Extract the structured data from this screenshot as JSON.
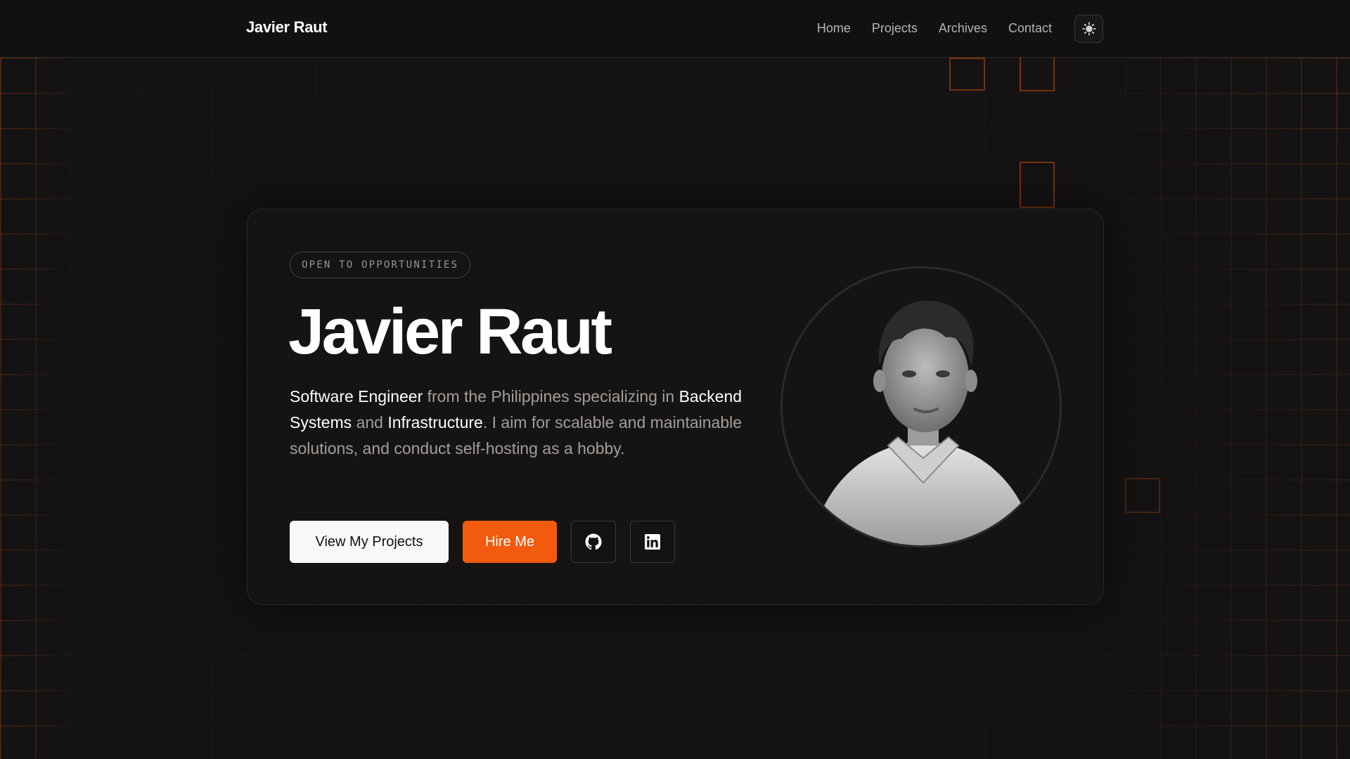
{
  "header": {
    "brand": "Javier Raut",
    "nav": [
      {
        "label": "Home"
      },
      {
        "label": "Projects"
      },
      {
        "label": "Archives"
      },
      {
        "label": "Contact"
      }
    ],
    "theme_toggle_icon": "sun-icon"
  },
  "hero": {
    "badge": "OPEN TO OPPORTUNITIES",
    "name": "Javier Raut",
    "bio": {
      "role": "Software Engineer",
      "text1": " from the Philippines specializing in ",
      "skill1": "Backend Systems",
      "text2": " and ",
      "skill2": "Infrastructure",
      "text3": ". I aim for scalable and maintainable solutions, and conduct self-hosting as a hobby."
    },
    "buttons": {
      "projects": "View My Projects",
      "hire": "Hire Me",
      "github_icon": "github-icon",
      "linkedin_icon": "linkedin-icon"
    },
    "avatar_icon": "profile-photo"
  },
  "colors": {
    "accent": "#f25a0e",
    "background": "#141212",
    "card": "#161413"
  }
}
